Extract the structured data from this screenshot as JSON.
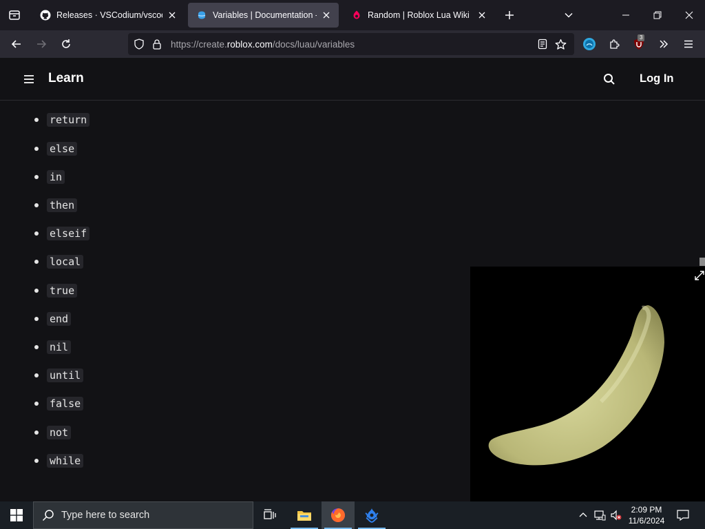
{
  "browser": {
    "tabs": [
      {
        "title": "Releases · VSCodium/vscodium",
        "icon": "github-icon",
        "active": false
      },
      {
        "title": "Variables | Documentation - Roblox Creator Hub",
        "icon": "roblox-docs-icon",
        "active": true
      },
      {
        "title": "Random | Roblox Lua Wiki | Fandom",
        "icon": "fandom-icon",
        "active": false
      }
    ],
    "url_prefix": "https://create.",
    "url_host": "roblox.com",
    "url_path": "/docs/luau/variables",
    "extension_badge": "3"
  },
  "site": {
    "title": "Learn",
    "login_label": "Log In"
  },
  "keywords": [
    "return",
    "else",
    "in",
    "then",
    "elseif",
    "local",
    "true",
    "end",
    "nil",
    "until",
    "false",
    "not",
    "while"
  ],
  "taskbar": {
    "search_placeholder": "Type here to search",
    "time": "2:09 PM",
    "date": "11/6/2024"
  },
  "colors": {
    "page_bg": "#121215",
    "code_bg": "#26262b",
    "tab_active": "#42414d",
    "taskbar_accent": "#76b9ed"
  }
}
